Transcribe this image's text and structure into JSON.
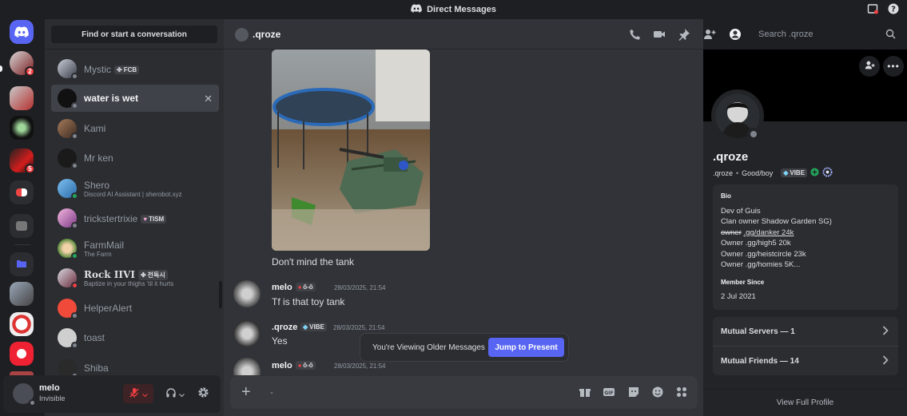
{
  "window": {
    "title": "Direct Messages"
  },
  "dm_list": {
    "find_label": "Find or start a conversation",
    "items": [
      {
        "name": "Mystic",
        "tag": "FCB",
        "sub": ""
      },
      {
        "name": "water is wet",
        "tag": "",
        "sub": ""
      },
      {
        "name": "Kami",
        "tag": "",
        "sub": ""
      },
      {
        "name": "Mr ken",
        "tag": "",
        "sub": ""
      },
      {
        "name": "Shero",
        "tag": "",
        "sub": "Discord AI Assistant | sherobot.xyz"
      },
      {
        "name": "trickstertrixie",
        "tag": "TISM",
        "sub": ""
      },
      {
        "name": "FarmMail",
        "tag": "",
        "sub": "The Farm"
      },
      {
        "name": "Rock IIVI",
        "tag": "전독시",
        "sub": "Baptize in your thighs 'til it hurts"
      },
      {
        "name": "HelperAlert",
        "tag": "",
        "sub": ""
      },
      {
        "name": "toast",
        "tag": "",
        "sub": ""
      },
      {
        "name": "Shiba",
        "tag": "",
        "sub": ""
      }
    ],
    "close_glyph": "✕"
  },
  "user_panel": {
    "name": "melo",
    "status": "Invisible"
  },
  "server_badges": {
    "s1": "2",
    "s4": "5"
  },
  "chat": {
    "header_name": ".qroze",
    "search_placeholder": "Search .qroze",
    "messages": [
      {
        "author": "",
        "text": "Don't mind the tank"
      },
      {
        "author": "melo",
        "tag": "ô-ô",
        "time": "28/03/2025, 21:54",
        "text": "Tf is that toy tank"
      },
      {
        "author": ".qroze",
        "tag": "VIBE",
        "time": "28/03/2025, 21:54",
        "text": "Yes"
      },
      {
        "author": "melo",
        "tag": "ô-ô",
        "time": "28/03/2025, 21:54",
        "text": ""
      }
    ],
    "older_banner": {
      "text": "You're Viewing Older Messages",
      "button": "Jump to Present"
    },
    "composer_placeholder": "-"
  },
  "profile": {
    "name": ".qroze",
    "username": ".qroze",
    "pronoun": "Good/boy",
    "clan_tag": "VIBE",
    "bio_heading": "Bio",
    "bio_lines": [
      "Dev of Guis",
      "Clan owner Shadow Garden SG)",
      ".gg/danker 24k",
      "Owner .gg/high5 20k",
      "Owner .gg/heistcircle 23k",
      "Owner .gg/homies 5K..."
    ],
    "bio_strike": "owner",
    "member_since_heading": "Member Since",
    "member_since": "2 Jul 2021",
    "mutual_servers": "Mutual Servers — 1",
    "mutual_friends": "Mutual Friends — 14",
    "view_full": "View Full Profile"
  },
  "colors": {
    "accent": "#5865f2",
    "danger": "#f23f43",
    "online": "#23a55a"
  }
}
